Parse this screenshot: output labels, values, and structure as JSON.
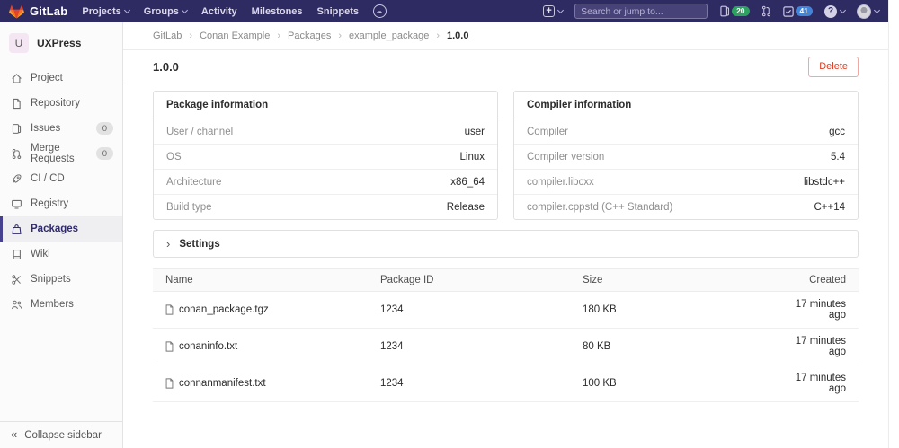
{
  "navbar": {
    "brand": "GitLab",
    "menu": {
      "projects": "Projects",
      "groups": "Groups",
      "activity": "Activity",
      "milestones": "Milestones",
      "snippets": "Snippets"
    },
    "search_placeholder": "Search or jump to...",
    "issues_count": "20",
    "todos_count": "41",
    "help_glyph": "?"
  },
  "sidebar": {
    "project_initial": "U",
    "project_name": "UXPress",
    "items": [
      {
        "label": "Project"
      },
      {
        "label": "Repository"
      },
      {
        "label": "Issues",
        "badge": "0"
      },
      {
        "label": "Merge Requests",
        "badge": "0"
      },
      {
        "label": "CI / CD"
      },
      {
        "label": "Registry"
      },
      {
        "label": "Packages"
      },
      {
        "label": "Wiki"
      },
      {
        "label": "Snippets"
      },
      {
        "label": "Members"
      }
    ],
    "collapse_label": "Collapse sidebar",
    "collapse_glyph": "«"
  },
  "breadcrumb": [
    "GitLab",
    "Conan Example",
    "Packages",
    "example_package",
    "1.0.0"
  ],
  "page": {
    "title": "1.0.0",
    "delete_label": "Delete"
  },
  "package_info": {
    "title": "Package information",
    "rows": [
      [
        "User / channel",
        "user"
      ],
      [
        "OS",
        "Linux"
      ],
      [
        "Architecture",
        "x86_64"
      ],
      [
        "Build type",
        "Release"
      ]
    ]
  },
  "compiler_info": {
    "title": "Compiler information",
    "rows": [
      [
        "Compiler",
        "gcc"
      ],
      [
        "Compiler version",
        "5.4"
      ],
      [
        "compiler.libcxx",
        "libstdc++"
      ],
      [
        "compiler.cppstd (C++ Standard)",
        "C++14"
      ]
    ]
  },
  "settings": {
    "title": "Settings",
    "chevron_glyph": "›"
  },
  "files_table": {
    "columns": [
      "Name",
      "Package ID",
      "Size",
      "Created"
    ],
    "rows": [
      {
        "name": "conan_package.tgz",
        "package_id": "1234",
        "size": "180 KB",
        "created": "17 minutes ago"
      },
      {
        "name": "conaninfo.txt",
        "package_id": "1234",
        "size": "80 KB",
        "created": "17 minutes ago"
      },
      {
        "name": "connanmanifest.txt",
        "package_id": "1234",
        "size": "100 KB",
        "created": "17 minutes ago"
      }
    ]
  },
  "colors": {
    "navbar_bg": "#2e2a62",
    "brand_orange": "#fc6d26",
    "badge_green": "#2da160",
    "badge_blue": "#4285d8",
    "delete_red": "#db3b21",
    "active_indigo": "#47428f"
  }
}
